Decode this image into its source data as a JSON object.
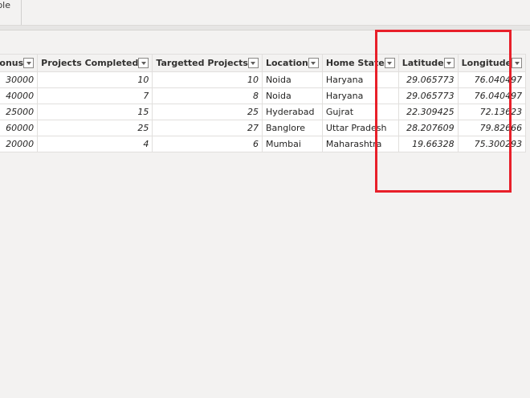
{
  "top_tab": {
    "label": "ble"
  },
  "table": {
    "columns": [
      "Bonus",
      "Projects Completed",
      "Targetted Projects",
      "Location",
      "Home State",
      "Latitude",
      "Longitude"
    ],
    "rows": [
      [
        "30000",
        "10",
        "10",
        "Noida",
        "Haryana",
        "29.065773",
        "76.040497"
      ],
      [
        "40000",
        "7",
        "8",
        "Noida",
        "Haryana",
        "29.065773",
        "76.040497"
      ],
      [
        "25000",
        "15",
        "25",
        "Hyderabad",
        "Gujrat",
        "22.309425",
        "72.13623"
      ],
      [
        "60000",
        "25",
        "27",
        "Banglore",
        "Uttar Pradesh",
        "28.207609",
        "79.82666"
      ],
      [
        "20000",
        "4",
        "6",
        "Mumbai",
        "Maharashtra",
        "19.66328",
        "75.300293"
      ]
    ]
  },
  "colors": {
    "highlight": "#e8202a",
    "grid_border": "#e1dfdd",
    "background": "#f3f2f1"
  }
}
